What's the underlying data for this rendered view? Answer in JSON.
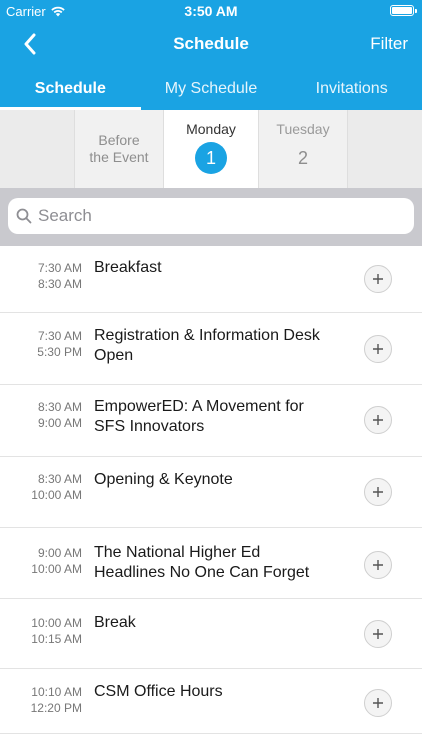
{
  "status_bar": {
    "carrier": "Carrier",
    "time": "3:50 AM"
  },
  "nav": {
    "title": "Schedule",
    "filter_label": "Filter"
  },
  "tabs": [
    {
      "label": "Schedule",
      "active": true
    },
    {
      "label": "My Schedule",
      "active": false
    },
    {
      "label": "Invitations",
      "active": false
    }
  ],
  "days": {
    "before_line1": "Before",
    "before_line2": "the Event",
    "monday": {
      "name": "Monday",
      "number": "1"
    },
    "tuesday": {
      "name": "Tuesday",
      "number": "2"
    }
  },
  "search": {
    "placeholder": "Search"
  },
  "sessions": [
    {
      "start": "7:30 AM",
      "end": "8:30 AM",
      "title": "Breakfast"
    },
    {
      "start": "7:30 AM",
      "end": "5:30 PM",
      "title": "Registration & Information Desk Open"
    },
    {
      "start": "8:30 AM",
      "end": "9:00 AM",
      "title": "EmpowerED: A Movement for SFS Innovators"
    },
    {
      "start": "8:30 AM",
      "end": "10:00 AM",
      "title": "Opening & Keynote"
    },
    {
      "start": "9:00 AM",
      "end": "10:00 AM",
      "title": "The National Higher Ed Headlines No One Can Forget"
    },
    {
      "start": "10:00 AM",
      "end": "10:15 AM",
      "title": "Break"
    },
    {
      "start": "10:10 AM",
      "end": "12:20 PM",
      "title": "CSM Office Hours"
    }
  ],
  "colors": {
    "accent": "#1aa3e3"
  }
}
